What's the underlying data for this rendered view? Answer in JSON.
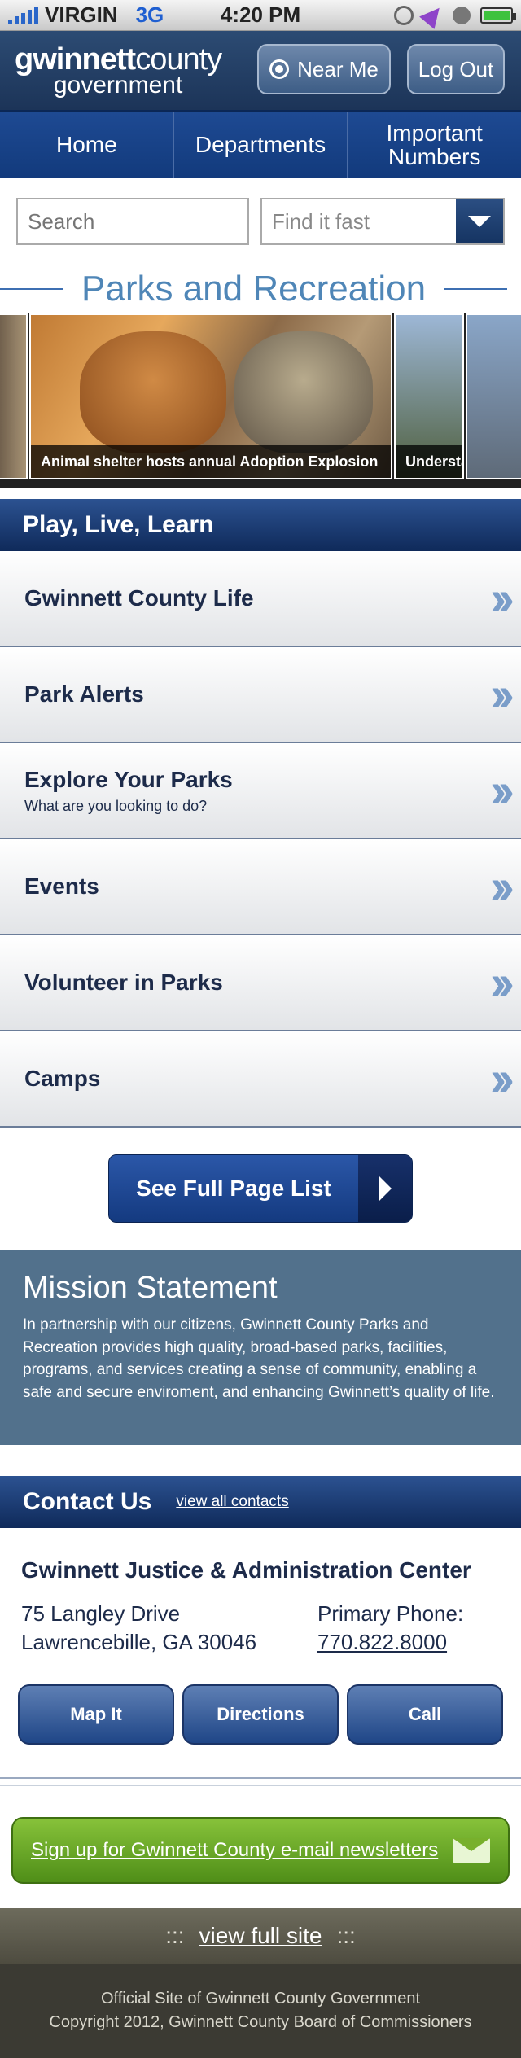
{
  "status_bar": {
    "carrier": "VIRGIN",
    "network": "3G",
    "time": "4:20 PM"
  },
  "header": {
    "logo_line1_bold": "gwinnett",
    "logo_line1_rest": "county",
    "logo_line2": "government",
    "near_me_label": "Near Me",
    "logout_label": "Log Out"
  },
  "nav": {
    "items": [
      "Home",
      "Departments",
      "Important Numbers"
    ]
  },
  "search": {
    "placeholder": "Search",
    "find_it_fast": "Find it fast"
  },
  "section_title": "Parks and Recreation",
  "carousel": {
    "captions": [
      "Animal shelter hosts annual Adoption Explosion",
      "Understanding yo"
    ]
  },
  "play_live_learn": {
    "heading": "Play, Live, Learn",
    "items": [
      {
        "title": "Gwinnett County Life",
        "subtitle": ""
      },
      {
        "title": "Park Alerts",
        "subtitle": ""
      },
      {
        "title": "Explore Your Parks",
        "subtitle": "What are you looking to do?"
      },
      {
        "title": "Events",
        "subtitle": ""
      },
      {
        "title": "Volunteer in Parks",
        "subtitle": ""
      },
      {
        "title": "Camps",
        "subtitle": ""
      }
    ]
  },
  "full_page_list_label": "See Full Page List",
  "mission": {
    "heading": "Mission Statement",
    "text": "In partnership with our citizens, Gwinnett County Parks and Recreation provides high quality, broad-based parks, facilities, programs, and services creating a sense of community, enabling a safe and secure enviroment, and enhancing Gwinnett’s quality of life."
  },
  "contact": {
    "heading": "Contact Us",
    "view_all": "view all contacts",
    "name": "Gwinnett Justice & Administration Center",
    "address_line1": "75 Langley Drive",
    "address_line2": "Lawrencebille, GA 30046",
    "phone_label": "Primary Phone:",
    "phone": "770.822.8000",
    "buttons": [
      "Map It",
      "Directions",
      "Call"
    ]
  },
  "newsletter_label": "Sign up for Gwinnett County e-mail newsletters",
  "footer": {
    "view_full_site": "view full site",
    "dots": ":::",
    "line1": "Official Site of Gwinnett County Government",
    "line2": "Copyright 2012, Gwinnett County Board of Commissioners"
  },
  "colors": {
    "nav_blue": "#1e4a93",
    "title_blue": "#4f86b7",
    "mission_bg": "#52718c",
    "newsletter_green": "#6aa82a",
    "footer_bg": "#3b3a33"
  }
}
